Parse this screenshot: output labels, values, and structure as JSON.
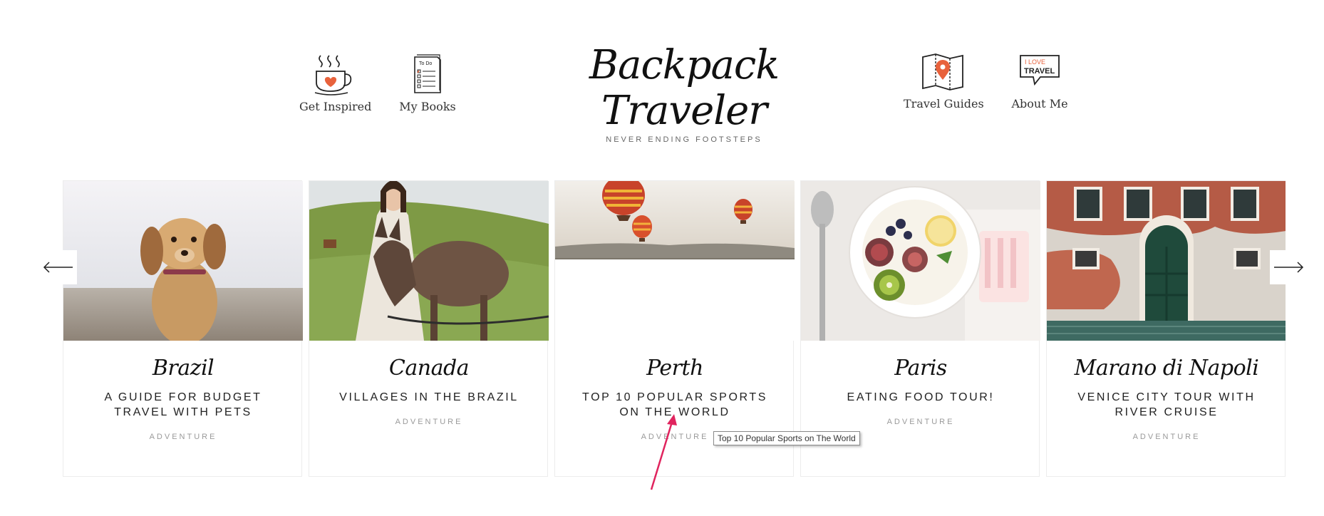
{
  "header": {
    "logo": {
      "title": "Backpack Traveler",
      "tagline": "NEVER ENDING FOOTSTEPS"
    },
    "nav_left": [
      {
        "label": "Get Inspired",
        "icon": "coffee-cup-icon"
      },
      {
        "label": "My Books",
        "icon": "todo-list-icon"
      }
    ],
    "nav_right": [
      {
        "label": "Travel Guides",
        "icon": "map-pin-icon"
      },
      {
        "label": "About Me",
        "icon": "i-love-travel-sign-icon"
      }
    ]
  },
  "icon_text": {
    "todo": "To Do",
    "sign_line1": "I LOVE",
    "sign_line2": "TRAVEL"
  },
  "slider": {
    "prev_icon": "arrow-left-icon",
    "next_icon": "arrow-right-icon",
    "cards": [
      {
        "location": "Brazil",
        "title_line1": "A GUIDE FOR BUDGET",
        "title_line2": "TRAVEL WITH PETS",
        "category": "ADVENTURE",
        "image": "dog-on-beach-photo"
      },
      {
        "location": "Canada",
        "title_line1": "VILLAGES IN THE BRAZIL",
        "title_line2": "",
        "category": "ADVENTURE",
        "image": "woman-with-donkey-photo"
      },
      {
        "location": "Perth",
        "title_line1": "TOP 10 POPULAR SPORTS",
        "title_line2": "ON THE WORLD",
        "category": "ADVENTURE",
        "image": "hot-air-balloons-photo"
      },
      {
        "location": "Paris",
        "title_line1": "EATING FOOD TOUR!",
        "title_line2": "",
        "category": "ADVENTURE",
        "image": "fruit-bowl-photo"
      },
      {
        "location": "Marano di Napoli",
        "title_line1": "VENICE CITY TOUR WITH",
        "title_line2": "RIVER CRUISE",
        "category": "ADVENTURE",
        "image": "venice-building-photo"
      }
    ]
  },
  "tooltip": {
    "text": "Top 10 Popular Sports on The World"
  },
  "colors": {
    "accent_orange": "#e8623c",
    "annotation_arrow": "#e0245e"
  }
}
